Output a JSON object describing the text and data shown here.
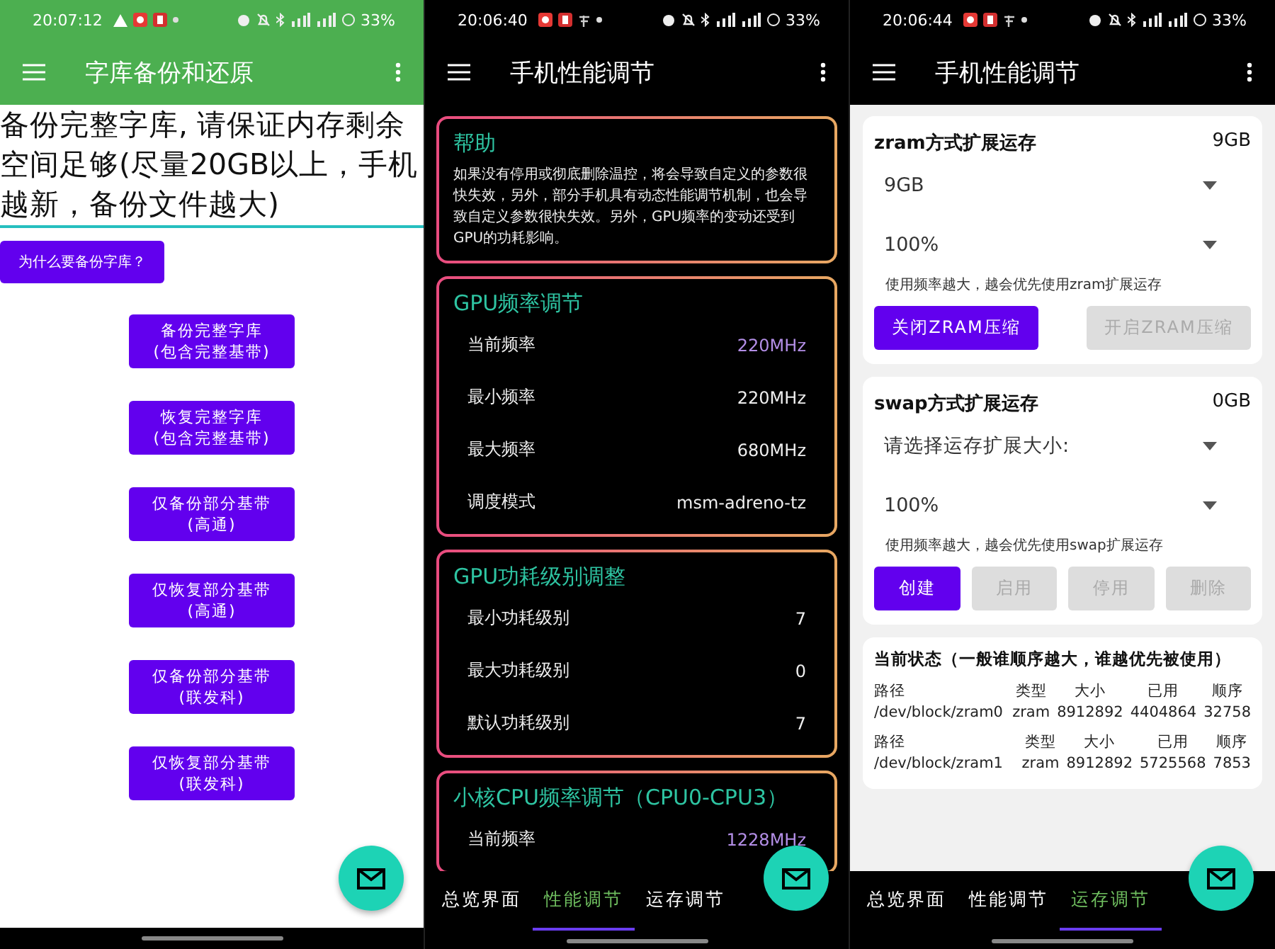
{
  "screens": [
    {
      "kind": "backup",
      "status_bar": {
        "time": "20:07:12",
        "battery": "33%"
      },
      "title": "字库备份和还原",
      "notice": "备份完整字库, 请保证内存剩余空间足够(尽量20GB以上，手机越新，备份文件越大)",
      "why_button": "为什么要备份字库？",
      "actions": [
        "备份完整字库\n(包含完整基带)",
        "恢复完整字库\n(包含完整基带)",
        "仅备份部分基带\n(高通)",
        "仅恢复部分基带\n(高通)",
        "仅备份部分基带\n(联发科)",
        "仅恢复部分基带\n(联发科)"
      ]
    },
    {
      "kind": "performance",
      "status_bar": {
        "time": "20:06:40",
        "battery": "33%"
      },
      "title": "手机性能调节",
      "cards": [
        {
          "title": "帮助",
          "text": "如果没有停用或彻底删除温控，将会导致自定义的参数很快失效，另外，部分手机具有动态性能调节机制，也会导致自定义参数很快失效。另外，GPU频率的变动还受到GPU的功耗影响。"
        },
        {
          "title": "GPU频率调节",
          "rows": [
            {
              "label": "当前频率",
              "value": "220MHz",
              "highlight": true
            },
            {
              "label": "最小频率",
              "value": "220MHz",
              "highlight": false
            },
            {
              "label": "最大频率",
              "value": "680MHz",
              "highlight": false
            },
            {
              "label": "调度模式",
              "value": "msm-adreno-tz",
              "highlight": false
            }
          ]
        },
        {
          "title": "GPU功耗级别调整",
          "rows": [
            {
              "label": "最小功耗级别",
              "value": "7",
              "highlight": false
            },
            {
              "label": "最大功耗级别",
              "value": "0",
              "highlight": false
            },
            {
              "label": "默认功耗级别",
              "value": "7",
              "highlight": false
            }
          ]
        },
        {
          "title": "小核CPU频率调节（CPU0-CPU3）",
          "rows": [
            {
              "label": "当前频率",
              "value": "1228MHz",
              "highlight": true
            }
          ]
        }
      ],
      "nav": [
        {
          "label": "总览界面",
          "selected": false
        },
        {
          "label": "性能调节",
          "selected": true
        },
        {
          "label": "运存调节",
          "selected": false
        }
      ]
    },
    {
      "kind": "memory",
      "status_bar": {
        "time": "20:06:44",
        "battery": "33%"
      },
      "title": "手机性能调节",
      "panels": [
        {
          "title": "zram方式扩展运存",
          "size": "9GB",
          "selects": [
            "9GB",
            "100%"
          ],
          "hint": "使用频率越大，越会优先使用zram扩展运存",
          "buttons": [
            {
              "label": "关闭ZRAM压缩",
              "disabled": false
            },
            {
              "label": "开启ZRAM压缩",
              "disabled": true
            }
          ]
        },
        {
          "title": "swap方式扩展运存",
          "size": "0GB",
          "selects": [
            "请选择运存扩展大小:",
            "100%"
          ],
          "hint": "使用频率越大，越会优先使用swap扩展运存",
          "buttons": [
            {
              "label": "创建",
              "disabled": false
            },
            {
              "label": "启用",
              "disabled": true
            },
            {
              "label": "停用",
              "disabled": true
            },
            {
              "label": "删除",
              "disabled": true
            }
          ]
        }
      ],
      "status": {
        "title": "当前状态（一般谁顺序越大，谁越优先被使用）",
        "entries": [
          {
            "headers": [
              "路径",
              "类型",
              "大小",
              "已用",
              "顺序"
            ],
            "values": [
              "/dev/block/zram0",
              "zram",
              "8912892",
              "4404864",
              "32758"
            ]
          },
          {
            "headers": [
              "路径",
              "类型",
              "大小",
              "已用",
              "顺序"
            ],
            "values": [
              "/dev/block/zram1",
              "zram",
              "8912892",
              "5725568",
              "7853"
            ]
          }
        ]
      },
      "nav": [
        {
          "label": "总览界面",
          "selected": false
        },
        {
          "label": "性能调节",
          "selected": false
        },
        {
          "label": "运存调节",
          "selected": true
        }
      ]
    }
  ]
}
